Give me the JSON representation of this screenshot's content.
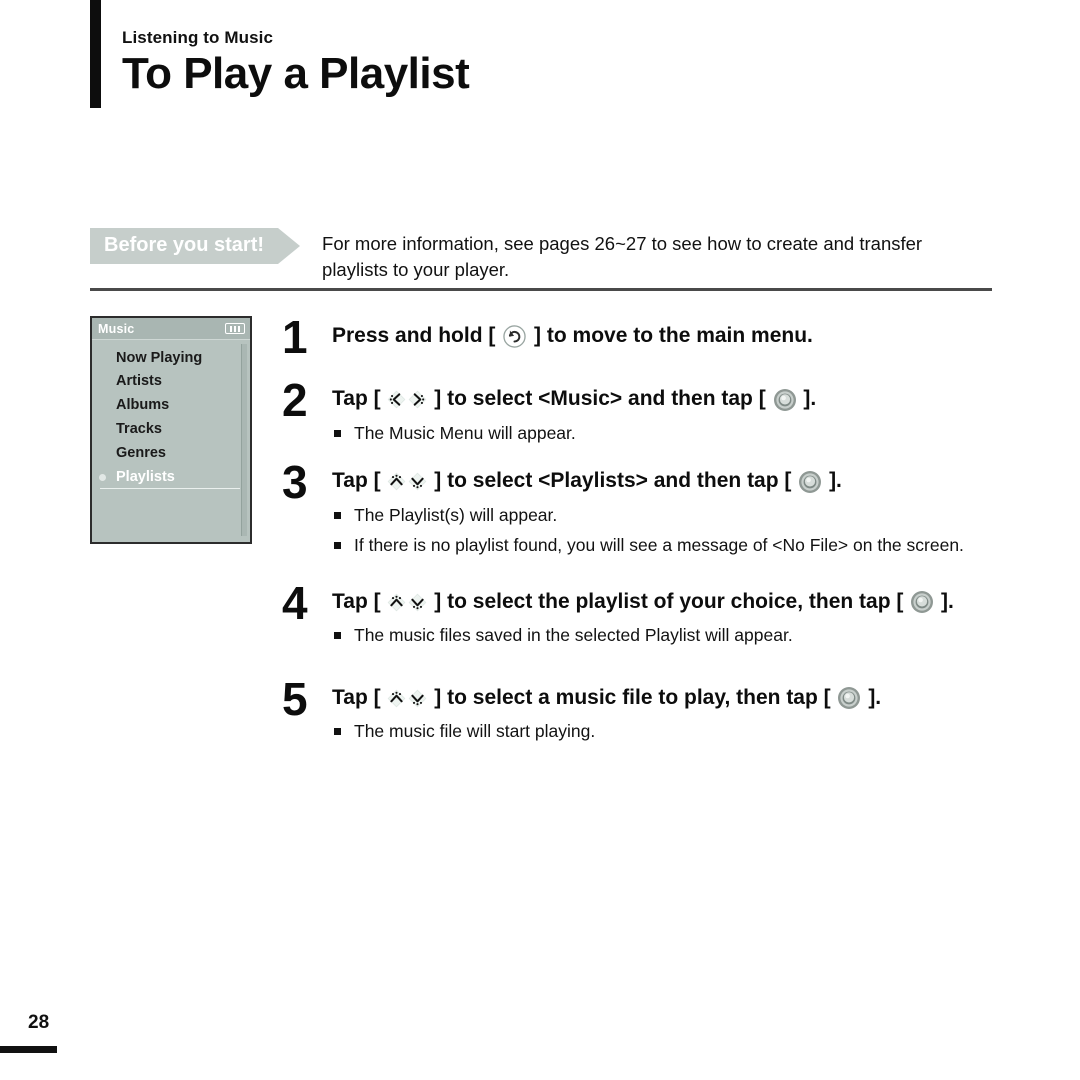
{
  "header": {
    "eyebrow": "Listening to Music",
    "title": "To Play a Playlist"
  },
  "notice": {
    "tag_label": "Before you start!",
    "body": "For more information, see pages 26~27 to see how to create and transfer playlists to your player."
  },
  "device": {
    "title": "Music",
    "battery_icon": "battery-icon",
    "items": [
      {
        "label": "Now Playing",
        "selected": false
      },
      {
        "label": "Artists",
        "selected": false
      },
      {
        "label": "Albums",
        "selected": false
      },
      {
        "label": "Tracks",
        "selected": false
      },
      {
        "label": "Genres",
        "selected": false
      },
      {
        "label": "Playlists",
        "selected": true
      }
    ]
  },
  "steps": [
    {
      "number": "1",
      "head_parts": [
        {
          "type": "text",
          "value": "Press and hold [ "
        },
        {
          "type": "icon",
          "value": "return-icon"
        },
        {
          "type": "text",
          "value": " ] to move to the main menu."
        }
      ],
      "notes": []
    },
    {
      "number": "2",
      "head_parts": [
        {
          "type": "text",
          "value": "Tap [ "
        },
        {
          "type": "icon",
          "value": "chevron-left-touch-icon"
        },
        {
          "type": "icon",
          "value": "chevron-right-touch-icon"
        },
        {
          "type": "text",
          "value": " ] to select <Music> and then tap [ "
        },
        {
          "type": "icon",
          "value": "select-button-icon"
        },
        {
          "type": "text",
          "value": " ]."
        }
      ],
      "notes": [
        "The Music Menu will appear."
      ]
    },
    {
      "number": "3",
      "head_parts": [
        {
          "type": "text",
          "value": "Tap [ "
        },
        {
          "type": "icon",
          "value": "chevron-up-touch-icon"
        },
        {
          "type": "icon",
          "value": "chevron-down-touch-icon"
        },
        {
          "type": "text",
          "value": " ] to select <Playlists> and then tap [ "
        },
        {
          "type": "icon",
          "value": "select-button-icon"
        },
        {
          "type": "text",
          "value": " ]."
        }
      ],
      "notes": [
        "The Playlist(s) will appear.",
        "If there is no playlist found, you will see a message of <No File> on the screen."
      ]
    },
    {
      "number": "4",
      "head_parts": [
        {
          "type": "text",
          "value": "Tap [ "
        },
        {
          "type": "icon",
          "value": "chevron-up-touch-icon"
        },
        {
          "type": "icon",
          "value": "chevron-down-touch-icon"
        },
        {
          "type": "text",
          "value": " ] to select the playlist of your choice, then tap [ "
        },
        {
          "type": "icon",
          "value": "select-button-icon"
        },
        {
          "type": "text",
          "value": " ]."
        }
      ],
      "notes": [
        "The music files saved in the selected Playlist will appear."
      ]
    },
    {
      "number": "5",
      "head_parts": [
        {
          "type": "text",
          "value": "Tap [ "
        },
        {
          "type": "icon",
          "value": "chevron-up-touch-icon"
        },
        {
          "type": "icon",
          "value": "chevron-down-touch-icon"
        },
        {
          "type": "text",
          "value": " ] to select a music file to play, then tap [ "
        },
        {
          "type": "icon",
          "value": "select-button-icon"
        },
        {
          "type": "text",
          "value": " ]."
        }
      ],
      "notes": [
        "The music file will start playing."
      ]
    }
  ],
  "footer": {
    "page_number": "28"
  },
  "colors": {
    "accent_banner": "#c6cecb",
    "device_screen": "#b7c3bf",
    "device_titlebar": "#a9b6b2",
    "ink": "#0d0d0d"
  }
}
